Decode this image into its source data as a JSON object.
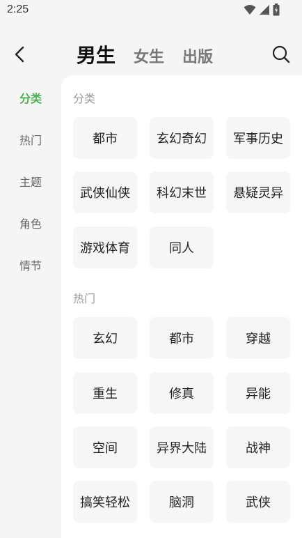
{
  "status": {
    "time": "2:25",
    "icons": [
      "wifi-icon",
      "signal-icon",
      "battery-icon"
    ]
  },
  "header": {
    "tabs": [
      {
        "label": "男生",
        "active": true
      },
      {
        "label": "女生",
        "active": false
      },
      {
        "label": "出版",
        "active": false
      }
    ]
  },
  "sidebar": {
    "items": [
      {
        "label": "分类",
        "active": true
      },
      {
        "label": "热门",
        "active": false
      },
      {
        "label": "主题",
        "active": false
      },
      {
        "label": "角色",
        "active": false
      },
      {
        "label": "情节",
        "active": false
      }
    ]
  },
  "sections": [
    {
      "title": "分类",
      "chips": [
        "都市",
        "玄幻奇幻",
        "军事历史",
        "武侠仙侠",
        "科幻末世",
        "悬疑灵异",
        "游戏体育",
        "同人"
      ]
    },
    {
      "title": "热门",
      "chips": [
        "玄幻",
        "都市",
        "穿越",
        "重生",
        "修真",
        "异能",
        "空间",
        "异界大陆",
        "战神",
        "搞笑轻松",
        "脑洞",
        "武侠"
      ]
    }
  ],
  "colors": {
    "accent": "#4caf50",
    "chip_bg": "#f6f6f6",
    "page_bg": "#f5f5f5"
  }
}
